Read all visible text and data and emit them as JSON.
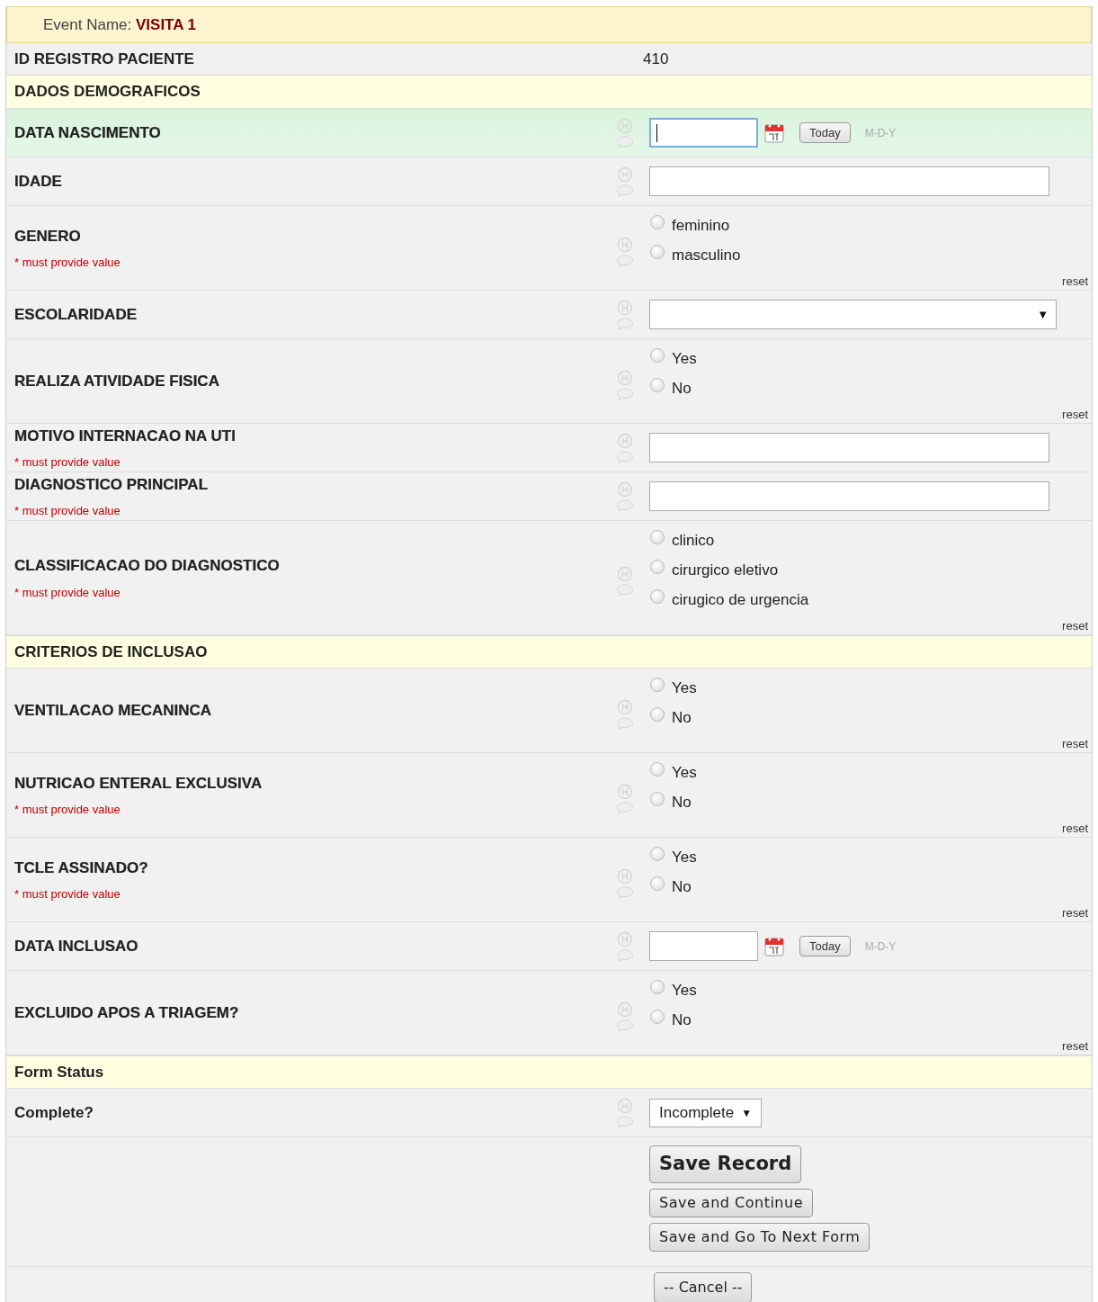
{
  "event": {
    "label": "Event Name:",
    "name": "VISITA 1"
  },
  "rows": [
    {
      "kind": "value",
      "label": "ID REGISTRO PACIENTE",
      "value": "410"
    },
    {
      "kind": "header",
      "label": "DADOS DEMOGRAFICOS"
    },
    {
      "kind": "date",
      "label": "DATA NASCIMENTO",
      "focused": true,
      "today": "Today",
      "format": "M-D-Y"
    },
    {
      "kind": "text",
      "label": "IDADE",
      "focused": false
    },
    {
      "kind": "radio",
      "label": "GENERO",
      "required_note": "* must provide value",
      "reset": "reset",
      "options": [
        {
          "label": "feminino",
          "selected": false
        },
        {
          "label": "masculino",
          "selected": false
        }
      ]
    },
    {
      "kind": "select",
      "label": "ESCOLARIDADE",
      "arrow": "▼"
    },
    {
      "kind": "radio",
      "label": "REALIZA ATIVIDADE FISICA",
      "reset": "reset",
      "options": [
        {
          "label": "Yes",
          "selected": false
        },
        {
          "label": "No",
          "selected": false
        }
      ]
    },
    {
      "kind": "text",
      "label": "MOTIVO INTERNACAO NA UTI",
      "required_note": "* must provide value",
      "focused": false
    },
    {
      "kind": "text",
      "label": "DIAGNOSTICO PRINCIPAL",
      "required_note": "* must provide value",
      "focused": false
    },
    {
      "kind": "radio",
      "label": "CLASSIFICACAO DO DIAGNOSTICO",
      "required_note": "* must provide value",
      "reset": "reset",
      "options": [
        {
          "label": "clinico",
          "selected": false
        },
        {
          "label": "cirurgico eletivo",
          "selected": false
        },
        {
          "label": "cirugico de urgencia",
          "selected": false
        }
      ]
    },
    {
      "kind": "header",
      "label": "CRITERIOS DE INCLUSAO"
    },
    {
      "kind": "radio",
      "label": "VENTILACAO MECANINCA",
      "reset": "reset",
      "options": [
        {
          "label": "Yes",
          "selected": false
        },
        {
          "label": "No",
          "selected": false
        }
      ]
    },
    {
      "kind": "radio",
      "label": "NUTRICAO ENTERAL EXCLUSIVA",
      "required_note": "* must provide value",
      "reset": "reset",
      "options": [
        {
          "label": "Yes",
          "selected": false
        },
        {
          "label": "No",
          "selected": false
        }
      ]
    },
    {
      "kind": "radio",
      "label": "TCLE ASSINADO?",
      "required_note": "* must provide value",
      "reset": "reset",
      "options": [
        {
          "label": "Yes",
          "selected": false
        },
        {
          "label": "No",
          "selected": false
        }
      ]
    },
    {
      "kind": "date",
      "label": "DATA INCLUSAO",
      "focused": false,
      "today": "Today",
      "format": "M-D-Y"
    },
    {
      "kind": "radio",
      "label": "EXCLUIDO APOS A TRIAGEM?",
      "reset": "reset",
      "options": [
        {
          "label": "Yes",
          "selected": false
        },
        {
          "label": "No",
          "selected": false
        }
      ]
    },
    {
      "kind": "header",
      "label": "Form Status"
    },
    {
      "kind": "status",
      "label": "Complete?",
      "value": "Incomplete",
      "arrow": "▼"
    },
    {
      "kind": "buttons",
      "buttons": [
        "Save Record",
        "Save and Continue",
        "Save and Go To Next Form"
      ]
    },
    {
      "kind": "cancel",
      "button": "-- Cancel --"
    }
  ]
}
